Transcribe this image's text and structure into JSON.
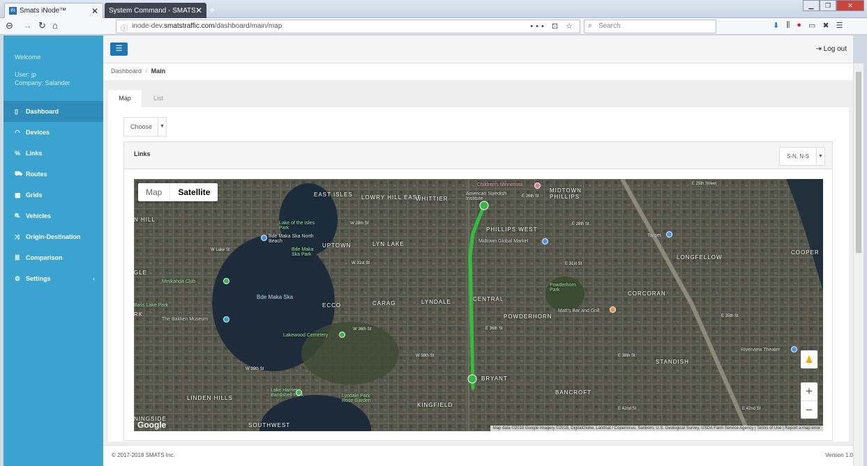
{
  "browser": {
    "tabs": [
      {
        "title": "Smats iNode™",
        "active": true
      },
      {
        "title": "System Command - SMATS (Smart",
        "active": false
      }
    ],
    "url_prefix": "inode-dev.",
    "url_host": "smatstraffic.com",
    "url_path": "/dashboard/main/map",
    "search_placeholder": "Search"
  },
  "sidebar": {
    "welcome": "Welcome",
    "user": "User: jp",
    "company": "Company: Salander",
    "items": [
      {
        "label": "Dashboard",
        "icon": "map-icon",
        "active": true
      },
      {
        "label": "Devices",
        "icon": "wifi-icon"
      },
      {
        "label": "Links",
        "icon": "link-icon"
      },
      {
        "label": "Routes",
        "icon": "road-icon"
      },
      {
        "label": "Grids",
        "icon": "grid-icon"
      },
      {
        "label": "Vehicles",
        "icon": "car-icon"
      },
      {
        "label": "Origin-Destination",
        "icon": "shuffle-icon"
      },
      {
        "label": "Comparison",
        "icon": "list-icon"
      },
      {
        "label": "Settings",
        "icon": "gear-icon"
      }
    ]
  },
  "header": {
    "logout": "Log out"
  },
  "breadcrumb": {
    "parent": "Dashboard",
    "separator": "/",
    "current": "Main"
  },
  "tabs": [
    {
      "label": "Map",
      "active": true
    },
    {
      "label": "List",
      "active": false
    }
  ],
  "filters": {
    "choose": "Choose",
    "direction": "S-N, N-S"
  },
  "panel": {
    "title": "Links"
  },
  "map": {
    "type_options": [
      "Map",
      "Satellite"
    ],
    "selected_type": "Satellite",
    "route_color": "#2fbf3a",
    "neighborhoods": [
      "EAST ISLES",
      "LOWRY HILL EAST",
      "WHITTIER",
      "MIDTOWN PHILLIPS",
      "PHILLIPS WEST",
      "UPTOWN",
      "LYN LAKE",
      "ECCO",
      "CARAG",
      "LYNDALE",
      "CENTRAL",
      "CORCORAN",
      "POWDERHORN",
      "LONGFELLOW",
      "COOPER",
      "STANDISH",
      "BRYANT",
      "BANCROFT",
      "KINGFIELD",
      "LINDEN HILLS",
      "SOUTHWEST",
      "N HILL",
      "GLE",
      "RK",
      "NINGSIDE"
    ],
    "places": [
      "Children's Minnesota",
      "American Swedish Institute",
      "Midtown Global Market",
      "Lake of the Isles Park",
      "Bde Maka Ska North Beach",
      "Bde Maka Ska Park",
      "Minikahda Club",
      "Bass Lake Park",
      "The Bakken Museum",
      "Bde Maka Ska",
      "Lakewood Cemetery",
      "Powderhorn Park",
      "Matt's Bar and Grill",
      "Target",
      "Riverview Theater",
      "Lake Harriet Bandshell Park",
      "Lyndale Park Rose Garden"
    ],
    "streets": [
      "E 25th Street",
      "W 28th St",
      "W Lake St",
      "W 31st St",
      "E 31st St",
      "W 36th St",
      "E 36th St",
      "W 38th St",
      "E 38th St",
      "E 42nd St",
      "W 39th St",
      "E 26th St",
      "E 28th St",
      "E 35th St",
      "E 42nd St"
    ],
    "attribution": "Map data ©2018 Google Imagery ©2018, DigitalGlobe, Landsat / Copernicus, Sanborn, U.S. Geological Survey, USDA Farm Service Agency | Terms of Use | Report a map error",
    "logo": "Google"
  },
  "footer": {
    "copyright": "© 2017-2018 SMATS Inc.",
    "version": "Version 1.0"
  }
}
